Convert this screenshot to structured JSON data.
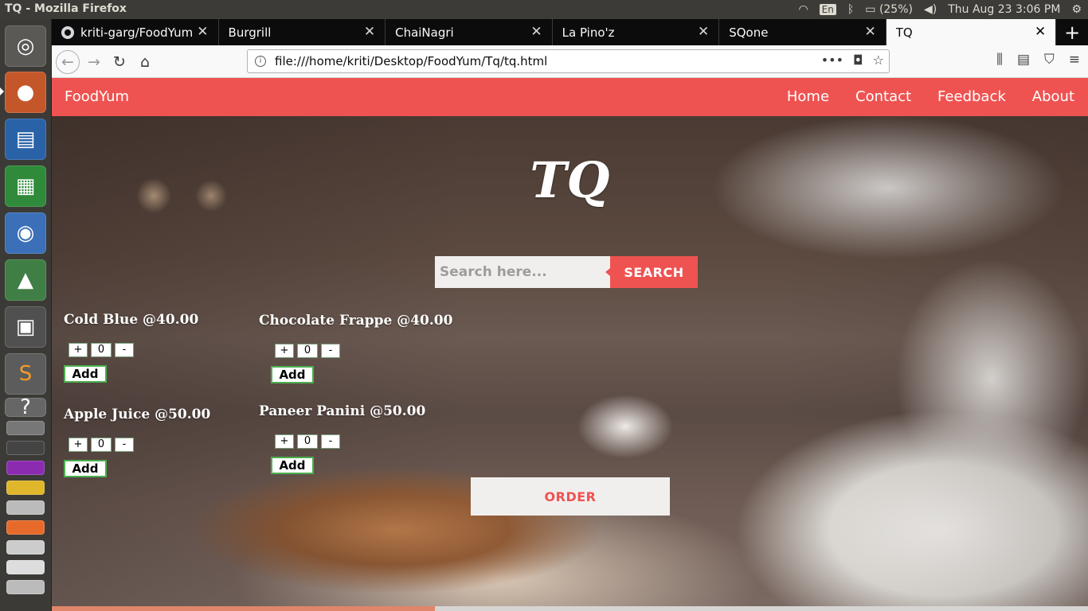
{
  "panel": {
    "window_title": "TQ - Mozilla Firefox",
    "keyboard": "En",
    "battery": "(25%)",
    "datetime": "Thu Aug 23  3:06 PM"
  },
  "launcher": {
    "apps": [
      "ubuntu-dash-icon",
      "firefox-icon",
      "writer-icon",
      "calc-icon",
      "chromium-icon",
      "android-studio-icon",
      "video-editor-icon",
      "sublime-text-icon",
      "help-icon"
    ]
  },
  "tabs": [
    {
      "label": "kriti-garg/FoodYum",
      "active": false
    },
    {
      "label": "Burgrill",
      "active": false
    },
    {
      "label": "ChaiNagri",
      "active": false
    },
    {
      "label": "La Pino'z",
      "active": false
    },
    {
      "label": "SQone",
      "active": false
    },
    {
      "label": "TQ",
      "active": true
    }
  ],
  "browser": {
    "url": "file:///home/kriti/Desktop/FoodYum/Tq/tq.html"
  },
  "site": {
    "brand": "FoodYum",
    "nav": [
      "Home",
      "Contact",
      "Feedback",
      "About"
    ],
    "title": "TQ",
    "search_placeholder": "Search here...",
    "search_button": "SEARCH",
    "order_button": "ORDER"
  },
  "menu": [
    {
      "name": "Cold Blue @40.00",
      "qty": "0",
      "add": "Add"
    },
    {
      "name": "Chocolate Frappe @40.00",
      "qty": "0",
      "add": "Add"
    },
    {
      "name": "Apple Juice @50.00",
      "qty": "0",
      "add": "Add"
    },
    {
      "name": "Paneer Panini @50.00",
      "qty": "0",
      "add": "Add"
    }
  ],
  "controls": {
    "plus": "+",
    "minus": "-"
  },
  "page_load_progress": 0.37,
  "colors": {
    "accent": "#ee5351",
    "add_border": "#4caf50"
  }
}
